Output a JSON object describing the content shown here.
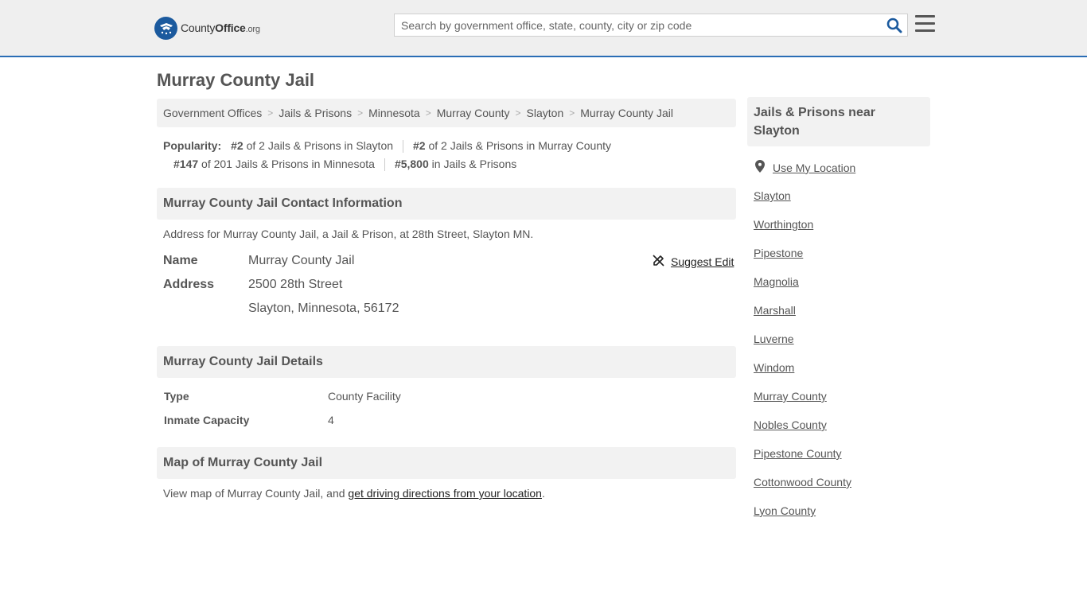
{
  "header": {
    "logo_brand": "County",
    "logo_bold": "Office",
    "logo_tld": ".org",
    "search_placeholder": "Search by government office, state, county, city or zip code",
    "accent_color": "#2a6db5",
    "search_icon": "search-icon",
    "menu_icon": "hamburger-menu-icon"
  },
  "page_title": "Murray County Jail",
  "breadcrumb": [
    "Government Offices",
    "Jails & Prisons",
    "Minnesota",
    "Murray County",
    "Slayton",
    "Murray County Jail"
  ],
  "popularity": {
    "label": "Popularity:",
    "items": [
      {
        "rank": "#2",
        "text": " of 2 Jails & Prisons in Slayton"
      },
      {
        "rank": "#2",
        "text": " of 2 Jails & Prisons in Murray County"
      },
      {
        "rank": "#147",
        "text": " of 201 Jails & Prisons in Minnesota"
      },
      {
        "rank": "#5,800",
        "text": " in Jails & Prisons"
      }
    ]
  },
  "contact": {
    "heading": "Murray County Jail Contact Information",
    "description": "Address for Murray County Jail, a Jail & Prison, at 28th Street, Slayton MN.",
    "name_label": "Name",
    "name_value": "Murray County Jail",
    "address_label": "Address",
    "address_line1": "2500 28th Street",
    "address_line2": "Slayton, Minnesota, 56172",
    "suggest_edit": "Suggest Edit"
  },
  "details": {
    "heading": "Murray County Jail Details",
    "rows": [
      {
        "label": "Type",
        "value": "County Facility"
      },
      {
        "label": "Inmate Capacity",
        "value": "4"
      }
    ]
  },
  "map": {
    "heading": "Map of Murray County Jail",
    "text_before": "View map of Murray County Jail, and ",
    "link": "get driving directions from your location",
    "text_after": "."
  },
  "sidebar": {
    "heading": "Jails & Prisons near Slayton",
    "use_location": "Use My Location",
    "links": [
      "Slayton",
      "Worthington",
      "Pipestone",
      "Magnolia",
      "Marshall",
      "Luverne",
      "Windom",
      "Murray County",
      "Nobles County",
      "Pipestone County",
      "Cottonwood County",
      "Lyon County"
    ]
  }
}
